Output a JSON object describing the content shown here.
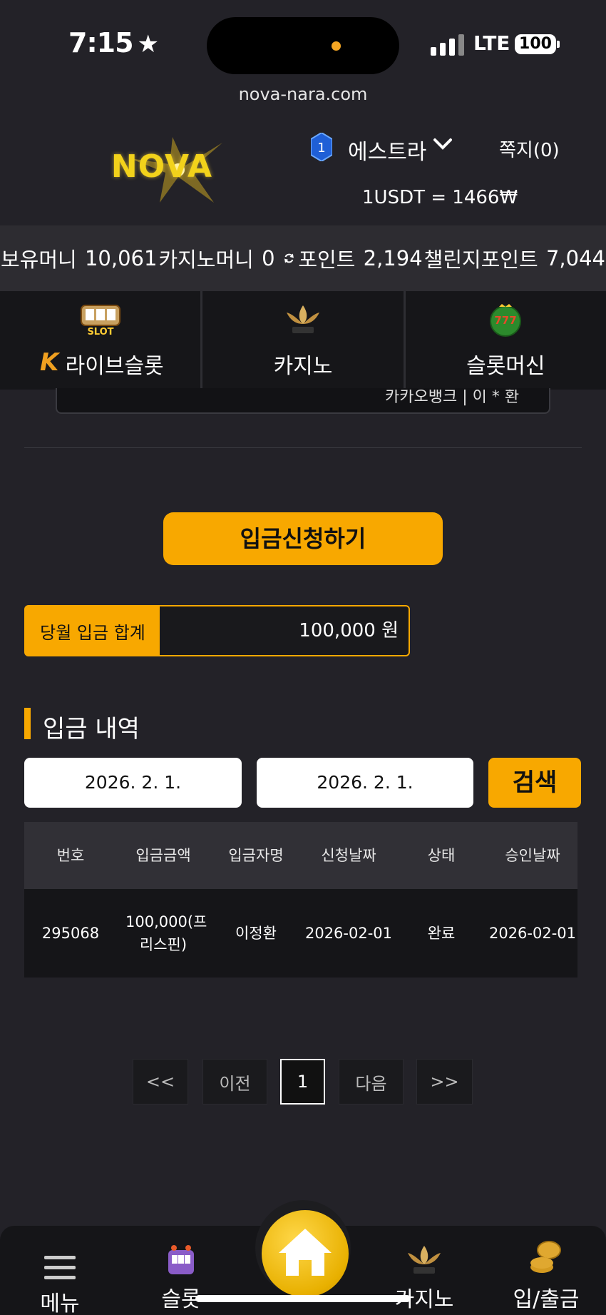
{
  "status": {
    "time": "7:15",
    "network": "LTE",
    "battery": "100"
  },
  "browser": {
    "url": "nova-nara.com"
  },
  "header": {
    "logo_text": "NOVA",
    "level": "1",
    "username": "에스트라",
    "messages": "쪽지(0)",
    "rate": "1USDT = 1466₩"
  },
  "balances": {
    "money_label": "보유머니",
    "money_value": "10,061",
    "casino_label": "카지노머니",
    "casino_value": "0",
    "point_label": "포인트",
    "point_value": "2,194",
    "challenge_label": "챌린지포인트",
    "challenge_value": "7,044"
  },
  "tabs": [
    {
      "label": "라이브슬롯",
      "icon": "live-slot-icon",
      "badge": "K"
    },
    {
      "label": "카지노",
      "icon": "k-slot-icon"
    },
    {
      "label": "슬롯머신",
      "icon": "777-slots-icon"
    }
  ],
  "account_cut": "카카오뱅크 | 이 * 환",
  "apply_button": "입금신청하기",
  "monthly": {
    "label": "당월 입금 합계",
    "value": "100,000 원"
  },
  "history": {
    "title": "입금 내역",
    "date_from": "2026. 2. 1.",
    "date_to": "2026. 2. 1.",
    "search_label": "검색",
    "columns": [
      "번호",
      "입금금액",
      "입금자명",
      "신청날짜",
      "상태",
      "승인날짜"
    ],
    "rows": [
      {
        "no": "295068",
        "amount": "100,000(프리스핀)",
        "name": "이정환",
        "requested": "2026-02-01",
        "status": "완료",
        "approved": "2026-02-01"
      }
    ]
  },
  "pager": {
    "first": "<<",
    "prev": "이전",
    "current": "1",
    "next": "다음",
    "last": ">>"
  },
  "bottom_nav": {
    "menu": "메뉴",
    "slot": "슬롯",
    "casino": "카지노",
    "deposit": "입/출금"
  },
  "colors": {
    "accent": "#f8a800",
    "background": "#232228"
  }
}
